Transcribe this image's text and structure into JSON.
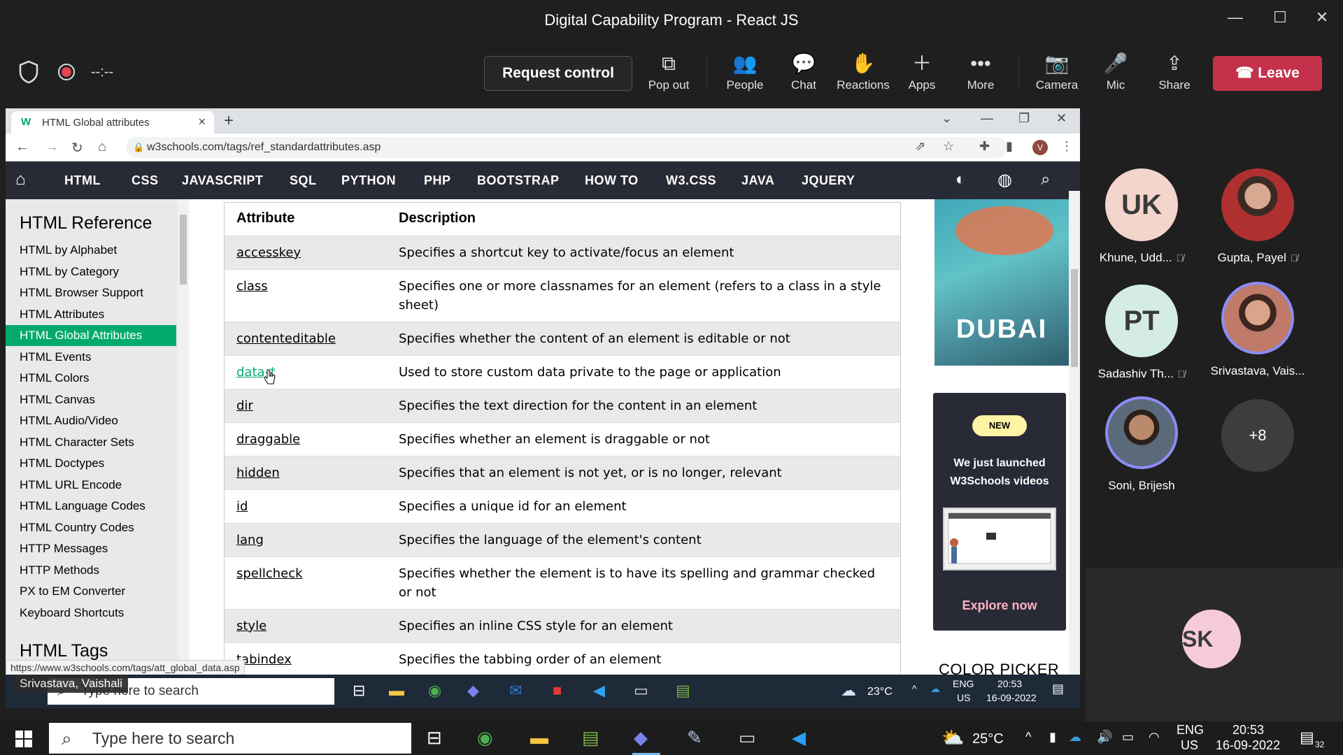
{
  "window": {
    "title": "Digital Capability Program - React JS",
    "controls": [
      "—",
      "☐",
      "✕"
    ]
  },
  "meeting_bar": {
    "timer": "--:--",
    "request_control": "Request control",
    "items": [
      {
        "label": "Pop out",
        "icon": "pop-out-icon"
      },
      {
        "label": "People",
        "icon": "people-icon"
      },
      {
        "label": "Chat",
        "icon": "chat-icon"
      },
      {
        "label": "Reactions",
        "icon": "reactions-icon"
      },
      {
        "label": "Apps",
        "icon": "apps-icon"
      },
      {
        "label": "More",
        "icon": "more-icon"
      },
      {
        "label": "Camera",
        "icon": "camera-off-icon"
      },
      {
        "label": "Mic",
        "icon": "mic-off-icon"
      },
      {
        "label": "Share",
        "icon": "share-icon"
      }
    ],
    "leave": "Leave",
    "colors": {
      "leave": "#c4314b"
    }
  },
  "browser": {
    "tab_title": "HTML Global attributes",
    "url": "w3schools.com/tags/ref_standardattributes.asp",
    "status_url": "https://www.w3schools.com/tags/att_global_data.asp",
    "avatar_letter": "V"
  },
  "w3nav": [
    "HTML",
    "CSS",
    "JAVASCRIPT",
    "SQL",
    "PYTHON",
    "PHP",
    "BOOTSTRAP",
    "HOW TO",
    "W3.CSS",
    "JAVA",
    "JQUERY"
  ],
  "sidebar": {
    "heading": "HTML Reference",
    "items": [
      "HTML by Alphabet",
      "HTML by Category",
      "HTML Browser Support",
      "HTML Attributes",
      "HTML Global Attributes",
      "HTML Events",
      "HTML Colors",
      "HTML Canvas",
      "HTML Audio/Video",
      "HTML Character Sets",
      "HTML Doctypes",
      "HTML URL Encode",
      "HTML Language Codes",
      "HTML Country Codes",
      "HTTP Messages",
      "HTTP Methods",
      "PX to EM Converter",
      "Keyboard Shortcuts"
    ],
    "next_heading": "HTML Tags",
    "active_index": 4
  },
  "table": {
    "headers": [
      "Attribute",
      "Description"
    ],
    "rows": [
      {
        "attr": "accesskey",
        "desc": "Specifies a shortcut key to activate/focus an element"
      },
      {
        "attr": "class",
        "desc": "Specifies one or more classnames for an element (refers to a class in a style sheet)"
      },
      {
        "attr": "contenteditable",
        "desc": "Specifies whether the content of an element is editable or not"
      },
      {
        "attr": "data-*",
        "desc": "Used to store custom data private to the page or application"
      },
      {
        "attr": "dir",
        "desc": "Specifies the text direction for the content in an element"
      },
      {
        "attr": "draggable",
        "desc": "Specifies whether an element is draggable or not"
      },
      {
        "attr": "hidden",
        "desc": "Specifies that an element is not yet, or is no longer, relevant"
      },
      {
        "attr": "id",
        "desc": "Specifies a unique id for an element"
      },
      {
        "attr": "lang",
        "desc": "Specifies the language of the element's content"
      },
      {
        "attr": "spellcheck",
        "desc": "Specifies whether the element is to have its spelling and grammar checked or not"
      },
      {
        "attr": "style",
        "desc": "Specifies an inline CSS style for an element"
      },
      {
        "attr": "tabindex",
        "desc": "Specifies the tabbing order of an element"
      }
    ]
  },
  "ads": {
    "image_text": "DUBAI",
    "video_badge": "NEW",
    "video_msg": "We just launched W3Schools videos",
    "explore": "Explore now",
    "color_picker": "COLOR PICKER"
  },
  "inner_taskbar": {
    "presenter": "Srivastava, Vaishali",
    "search_placeholder": "Type here to search",
    "weather": "23°C",
    "lang": "ENG",
    "region": "US",
    "time": "20:53",
    "date": "16-09-2022"
  },
  "participants": [
    {
      "initials": "UK",
      "name": "Khune, Udd...",
      "muted": true,
      "bg": "#f4d5cc"
    },
    {
      "initials": "",
      "name": "Gupta, Payel",
      "muted": true,
      "bg": "#b03030"
    },
    {
      "initials": "PT",
      "name": "Sadashiv Th...",
      "muted": true,
      "bg": "#d5ece2"
    },
    {
      "initials": "",
      "name": "Srivastava, Vais...",
      "muted": false,
      "bg": "#c07a6a"
    },
    {
      "initials": "",
      "name": "Soni, Brijesh",
      "muted": false,
      "bg": "#5a6a7a"
    },
    {
      "initials": "+8",
      "name": "",
      "muted": false,
      "bg": "#3d3d3d"
    }
  ],
  "self_view": {
    "initials": "SK"
  },
  "outer_taskbar": {
    "search_placeholder": "Type here to search",
    "weather": "25°C",
    "lang": "ENG",
    "region": "US",
    "time": "20:53",
    "date": "16-09-2022",
    "notifications": "32"
  }
}
